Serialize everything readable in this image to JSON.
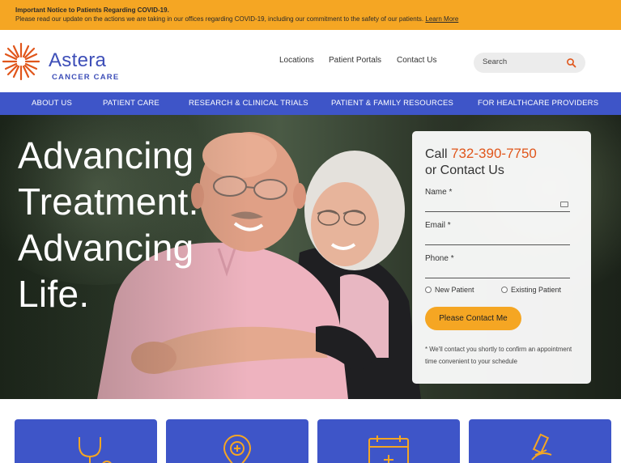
{
  "alert": {
    "title": "Important Notice to Patients Regarding COVID-19.",
    "message": "Please read our update on the actions we are taking in our offices regarding COVID-19, including our commitment to the safety of our patients.",
    "link": "Learn More"
  },
  "brand": {
    "name": "Astera",
    "tagline": "CANCER CARE"
  },
  "topnav": [
    "Locations",
    "Patient Portals",
    "Contact Us"
  ],
  "search": {
    "placeholder": "Search"
  },
  "mainnav": [
    "ABOUT US",
    "PATIENT CARE",
    "RESEARCH & CLINICAL TRIALS",
    "PATIENT & FAMILY RESOURCES",
    "FOR HEALTHCARE PROVIDERS"
  ],
  "hero": {
    "headline": [
      "Advancing",
      "Treatment.",
      "Advancing",
      "Life."
    ]
  },
  "contact_form": {
    "call_prefix": "Call ",
    "phone": "732-390-7750",
    "or_contact": "or Contact Us",
    "fields": [
      "Name *",
      "Email *",
      "Phone *"
    ],
    "patient_types": [
      "New Patient",
      "Existing Patient"
    ],
    "submit": "Please Contact Me",
    "note": "* We'll contact you shortly to confirm an appointment time convenient to your schedule"
  },
  "tiles": [
    "stethoscope-icon",
    "location-pin-plus-icon",
    "calendar-icon",
    "microscope-icon"
  ],
  "colors": {
    "alert": "#f5a623",
    "brand_blue": "#3e55c8",
    "accent_orange": "#e0561b"
  }
}
